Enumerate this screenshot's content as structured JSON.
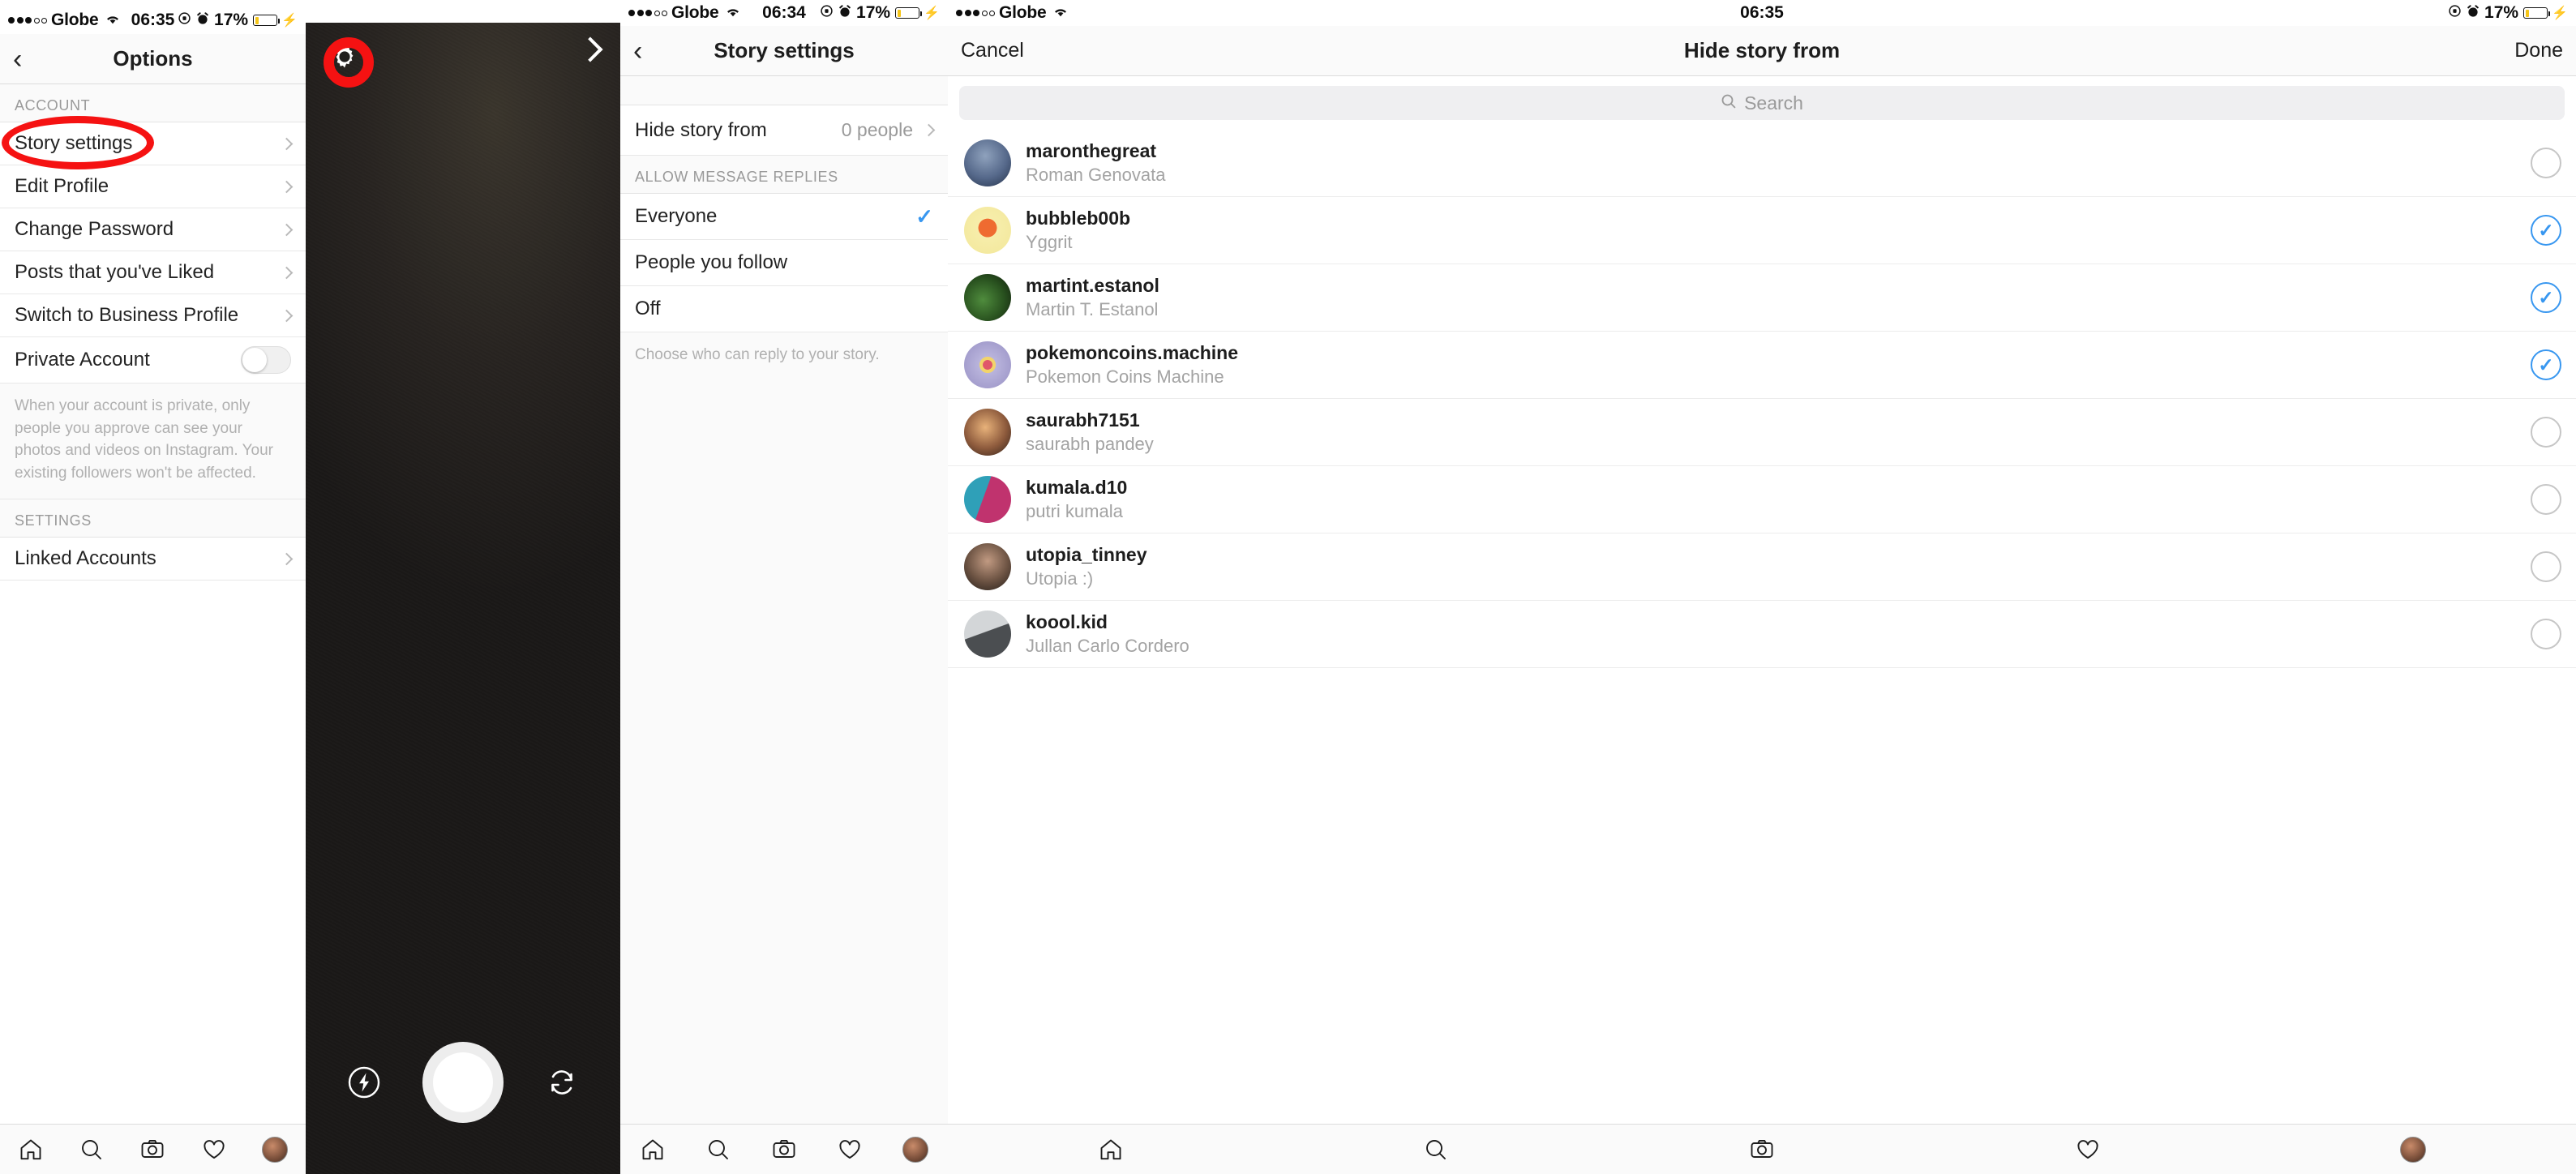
{
  "panels": {
    "options": {
      "status": {
        "carrier": "Globe",
        "time": "06:35",
        "battery_pct": "17%",
        "wifi_icon": "wifi-icon",
        "lock_icon": "rotation-lock-icon",
        "alarm_icon": "alarm-icon",
        "charging_icon": "charging-bolt-icon"
      },
      "nav": {
        "back_icon": "back-chevron-icon",
        "title": "Options"
      },
      "section_account": "ACCOUNT",
      "section_settings": "SETTINGS",
      "items": [
        {
          "label": "Story settings",
          "accessory": "chevron"
        },
        {
          "label": "Edit Profile",
          "accessory": "chevron"
        },
        {
          "label": "Change Password",
          "accessory": "chevron"
        },
        {
          "label": "Posts that you've Liked",
          "accessory": "chevron"
        },
        {
          "label": "Switch to Business Profile",
          "accessory": "chevron"
        }
      ],
      "private_account": {
        "label": "Private Account",
        "toggle_state": "off"
      },
      "private_note": "When your account is private, only people you approve can see your photos and videos on Instagram. Your existing followers won't be affected.",
      "settings_items": [
        {
          "label": "Linked Accounts",
          "accessory": "chevron"
        }
      ],
      "annotation": "red-ellipse-on-story-settings"
    },
    "camera": {
      "gear_icon": "gear-icon",
      "next_icon": "next-chevron-icon",
      "flash_icon": "flash-icon",
      "shutter_icon": "shutter-button",
      "flip_icon": "flip-camera-icon",
      "annotation": "red-circle-on-gear-icon"
    },
    "story_settings": {
      "status": {
        "carrier": "Globe",
        "time": "06:34",
        "battery_pct": "17%"
      },
      "nav": {
        "back_icon": "back-chevron-icon",
        "title": "Story settings"
      },
      "hide_story": {
        "label": "Hide story from",
        "value": "0 people"
      },
      "section_replies": "ALLOW MESSAGE REPLIES",
      "reply_options": [
        {
          "label": "Everyone",
          "selected": true
        },
        {
          "label": "People you follow",
          "selected": false
        },
        {
          "label": "Off",
          "selected": false
        }
      ],
      "reply_note": "Choose who can reply to your story."
    },
    "hide_story_from": {
      "status": {
        "carrier": "Globe",
        "time": "06:35",
        "battery_pct": "17%"
      },
      "nav": {
        "cancel": "Cancel",
        "title": "Hide story from",
        "done": "Done"
      },
      "search": {
        "placeholder": "Search",
        "icon": "search-icon"
      },
      "users": [
        {
          "username": "maronthegreat",
          "fullname": "Roman Genovata",
          "selected": false,
          "avatar_colors": [
            "#6d7f9b",
            "#2c3a55"
          ]
        },
        {
          "username": "bubbleb00b",
          "fullname": "Yggrit",
          "selected": true,
          "avatar_colors": [
            "#f4e9a0",
            "#e0532a"
          ]
        },
        {
          "username": "martint.estanol",
          "fullname": "Martin T. Estanol",
          "selected": true,
          "avatar_colors": [
            "#3f6b35",
            "#16240f"
          ]
        },
        {
          "username": "pokemoncoins.machine",
          "fullname": "Pokemon Coins Machine",
          "selected": true,
          "avatar_colors": [
            "#c9c6e0",
            "#8d86b8"
          ]
        },
        {
          "username": "saurabh7151",
          "fullname": "saurabh pandey",
          "selected": false,
          "avatar_colors": [
            "#d9a46a",
            "#3a2a24"
          ]
        },
        {
          "username": "kumala.d10",
          "fullname": "putri kumala",
          "selected": false,
          "avatar_colors": [
            "#2fa0b8",
            "#c0336e"
          ]
        },
        {
          "username": "utopia_tinney",
          "fullname": "Utopia :)",
          "selected": false,
          "avatar_colors": [
            "#8c6f5d",
            "#2a2420"
          ]
        },
        {
          "username": "koool.kid",
          "fullname": "Jullan Carlo Cordero",
          "selected": false,
          "avatar_colors": [
            "#b9bcbe",
            "#3c3f42"
          ]
        }
      ]
    }
  },
  "tabbar": {
    "items": [
      {
        "name": "home-icon",
        "label": "Home"
      },
      {
        "name": "search-icon",
        "label": "Search"
      },
      {
        "name": "camera-icon",
        "label": "Camera"
      },
      {
        "name": "heart-icon",
        "label": "Activity"
      },
      {
        "name": "profile-avatar",
        "label": "Profile"
      }
    ]
  },
  "colors": {
    "accent": "#3897f0",
    "annotation": "#f51212",
    "battery": "#f5c518"
  }
}
